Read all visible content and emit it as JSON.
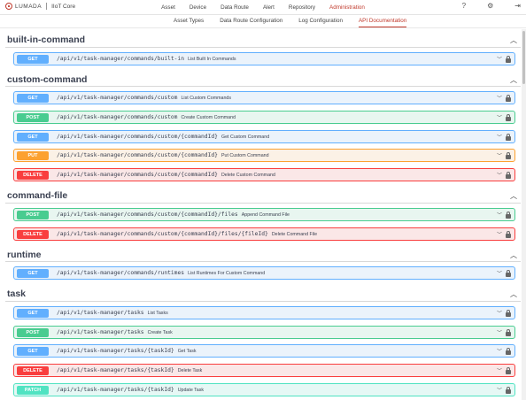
{
  "header": {
    "brand": "LUMADA",
    "product": "IIoT Core",
    "nav": [
      "Asset",
      "Device",
      "Data Route",
      "Alert",
      "Repository",
      "Administration"
    ],
    "active_nav": "Administration",
    "icons": [
      "help-icon",
      "settings-icon",
      "logout-icon"
    ]
  },
  "subnav": {
    "tabs": [
      "Asset Types",
      "Data Route Configuration",
      "Log Configuration",
      "API Documentation"
    ],
    "active": "API Documentation"
  },
  "colors": {
    "get": "#61affe",
    "post": "#49cc90",
    "put": "#fca130",
    "delete": "#f93e3e",
    "patch": "#50e3c2",
    "accent": "#c0392b"
  },
  "sections": [
    {
      "title": "built-in-command",
      "ops": [
        {
          "method": "GET",
          "path": "/api/v1/task-manager/commands/built-in",
          "summary": "List Built In Commands"
        }
      ]
    },
    {
      "title": "custom-command",
      "ops": [
        {
          "method": "GET",
          "path": "/api/v1/task-manager/commands/custom",
          "summary": "List Custom Commands"
        },
        {
          "method": "POST",
          "path": "/api/v1/task-manager/commands/custom",
          "summary": "Create Custom Command"
        },
        {
          "method": "GET",
          "path": "/api/v1/task-manager/commands/custom/{commandId}",
          "summary": "Get Custom Command"
        },
        {
          "method": "PUT",
          "path": "/api/v1/task-manager/commands/custom/{commandId}",
          "summary": "Put Custom Command"
        },
        {
          "method": "DELETE",
          "path": "/api/v1/task-manager/commands/custom/{commandId}",
          "summary": "Delete Custom Command"
        }
      ]
    },
    {
      "title": "command-file",
      "ops": [
        {
          "method": "POST",
          "path": "/api/v1/task-manager/commands/custom/{commandId}/files",
          "summary": "Append Command File"
        },
        {
          "method": "DELETE",
          "path": "/api/v1/task-manager/commands/custom/{commandId}/files/{fileId}",
          "summary": "Delete Command File"
        }
      ]
    },
    {
      "title": "runtime",
      "ops": [
        {
          "method": "GET",
          "path": "/api/v1/task-manager/commands/runtimes",
          "summary": "List Runtimes For Custom Command"
        }
      ]
    },
    {
      "title": "task",
      "ops": [
        {
          "method": "GET",
          "path": "/api/v1/task-manager/tasks",
          "summary": "List Tasks"
        },
        {
          "method": "POST",
          "path": "/api/v1/task-manager/tasks",
          "summary": "Create Task"
        },
        {
          "method": "GET",
          "path": "/api/v1/task-manager/tasks/{taskId}",
          "summary": "Get Task"
        },
        {
          "method": "DELETE",
          "path": "/api/v1/task-manager/tasks/{taskId}",
          "summary": "Delete Task"
        },
        {
          "method": "PATCH",
          "path": "/api/v1/task-manager/tasks/{taskId}",
          "summary": "Update Task"
        }
      ]
    }
  ]
}
